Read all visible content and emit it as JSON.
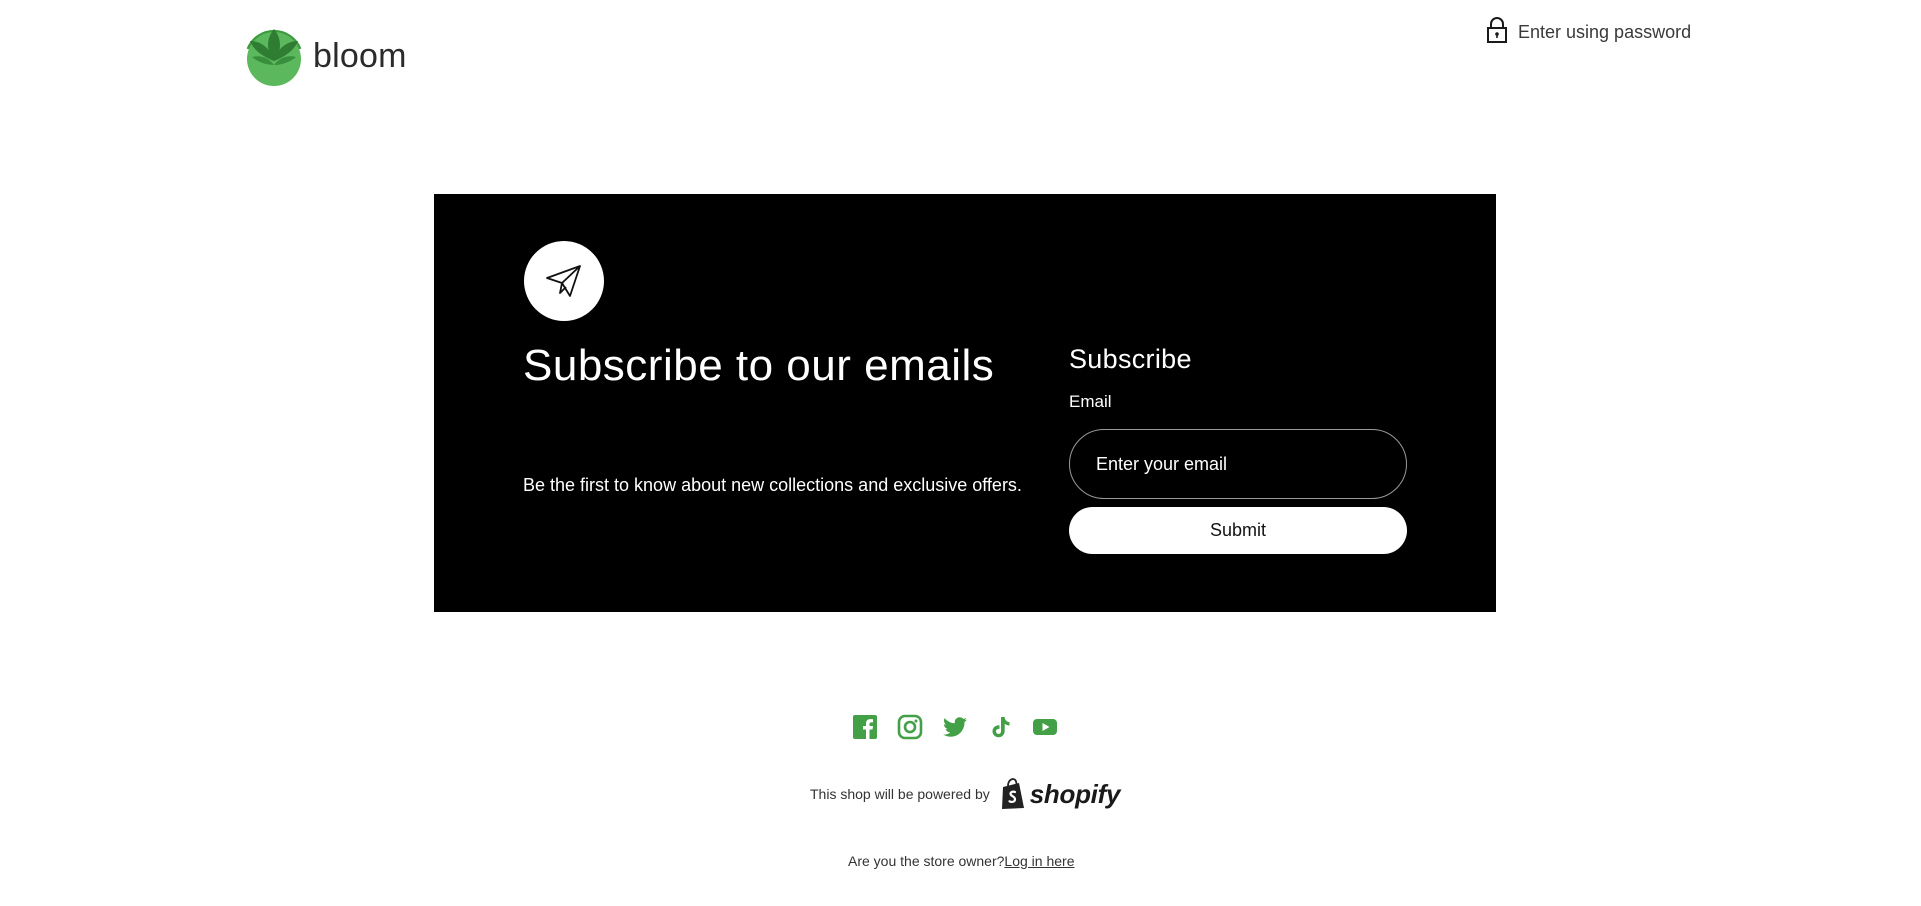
{
  "header": {
    "logo_text": "bloom",
    "password_link": "Enter using password"
  },
  "newsletter": {
    "heading": "Subscribe to our emails",
    "subtext": "Be the first to know about new collections and exclusive offers.",
    "form_title": "Subscribe",
    "email_label": "Email",
    "email_placeholder": "Enter your email",
    "email_value": "",
    "submit_label": "Submit"
  },
  "social": {
    "icons": [
      "facebook-icon",
      "instagram-icon",
      "twitter-icon",
      "tiktok-icon",
      "youtube-icon"
    ],
    "color": "#43a047"
  },
  "footer": {
    "powered_text": "This shop will be powered by",
    "shopify_label": "shopify",
    "owner_question": "Are you the store owner?",
    "login_link": "Log in here"
  },
  "colors": {
    "brand_green": "#4caf50",
    "brand_green_dark": "#2e7d32",
    "newsletter_bg": "#000000",
    "text": "#121212"
  }
}
